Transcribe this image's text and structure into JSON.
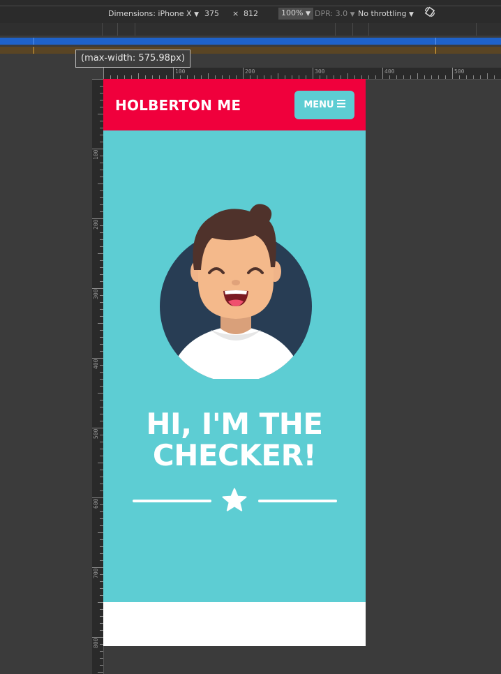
{
  "devtools": {
    "dimensions_label": "Dimensions: iPhone X",
    "width": "375",
    "times": "×",
    "height": "812",
    "zoom": "100%",
    "dpr": "DPR: 3.0",
    "throttling": "No throttling",
    "rotate_icon": "rotate-icon",
    "media_query_tooltip": "(max-width: 575.98px)",
    "ruler_labels_h": [
      "100",
      "200",
      "300",
      "400",
      "500"
    ],
    "ruler_labels_v": [
      "100",
      "200",
      "300",
      "400",
      "500",
      "600",
      "700",
      "800"
    ]
  },
  "page": {
    "brand": "HOLBERTON ME",
    "menu_label": "MENU",
    "menu_icon": "hamburger-icon",
    "headline_line1": "HI, I'M THE",
    "headline_line2": "CHECKER!",
    "divider_icon": "star-icon"
  },
  "colors": {
    "navbar": "#f0003c",
    "hero": "#5dcdd3",
    "menu_button": "#5dcdd3",
    "avatar_bg": "#283d54",
    "text": "#ffffff"
  }
}
